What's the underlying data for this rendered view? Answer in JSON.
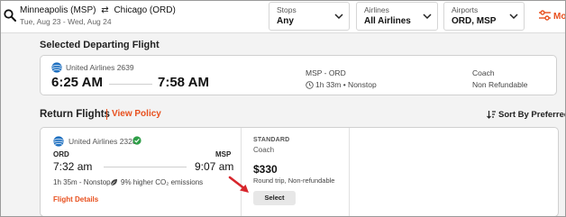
{
  "search": {
    "origin": "Minneapolis (MSP)",
    "destination": "Chicago (ORD)",
    "dates": "Tue, Aug 23 - Wed, Aug 24"
  },
  "filters": [
    {
      "label": "Stops",
      "value": "Any"
    },
    {
      "label": "Airlines",
      "value": "All Airlines"
    },
    {
      "label": "Airports",
      "value": "ORD, MSP"
    }
  ],
  "more_filters_label": "Mo",
  "departing": {
    "section_title": "Selected Departing Flight",
    "airline": "United Airlines 2639",
    "depart_time": "6:25 AM",
    "arrive_time": "7:58 AM",
    "route": "MSP - ORD",
    "duration": "1h 33m • Nonstop",
    "cabin": "Coach",
    "refund": "Non Refundable"
  },
  "return": {
    "section_title": "Return Flights",
    "policy_link": "View Policy",
    "sort_label": "Sort By Preferred",
    "flight": {
      "airline": "United Airlines 2328",
      "from_code": "ORD",
      "to_code": "MSP",
      "depart_time": "7:32 am",
      "arrive_time": "9:07 am",
      "stops": "1h 35m - Nonstop -",
      "emissions": "9% higher CO₂ emissions",
      "details_link": "Flight Details"
    },
    "fare": {
      "tier": "STANDARD",
      "cabin": "Coach",
      "price": "$330",
      "terms": "Round trip, Non-refundable",
      "select_label": "Select"
    }
  },
  "colors": {
    "accent": "#e8501e",
    "airline_blue": "#1d6fc0",
    "check_green": "#2e9e47",
    "pointer_red": "#d7262c"
  },
  "icons": [
    "search-icon",
    "swap-arrows-icon",
    "chevron-down-icon",
    "filter-sliders-icon",
    "airline-globe-logo",
    "clock-icon",
    "sort-icon",
    "verified-check-icon",
    "leaf-icon",
    "pointer-arrow-icon"
  ]
}
